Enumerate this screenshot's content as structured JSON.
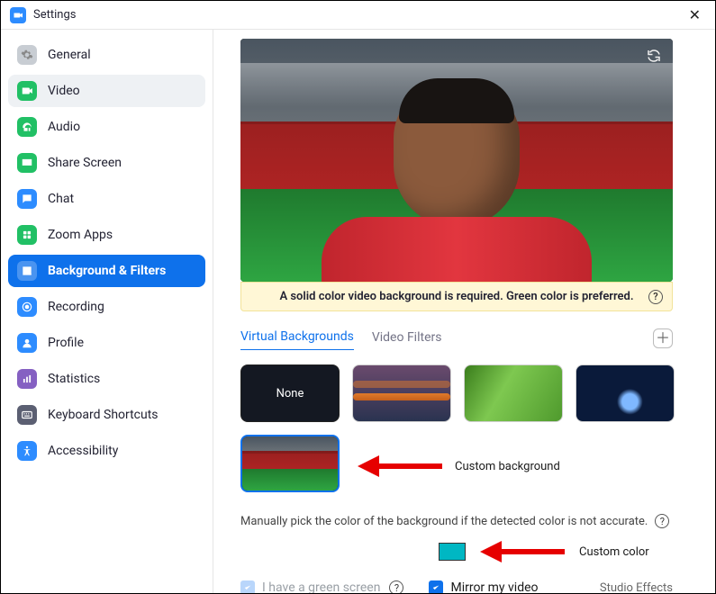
{
  "window": {
    "title": "Settings"
  },
  "sidebar": {
    "items": [
      {
        "label": "General"
      },
      {
        "label": "Video"
      },
      {
        "label": "Audio"
      },
      {
        "label": "Share Screen"
      },
      {
        "label": "Chat"
      },
      {
        "label": "Zoom Apps"
      },
      {
        "label": "Background & Filters"
      },
      {
        "label": "Recording"
      },
      {
        "label": "Profile"
      },
      {
        "label": "Statistics"
      },
      {
        "label": "Keyboard Shortcuts"
      },
      {
        "label": "Accessibility"
      }
    ]
  },
  "preview": {
    "note": "A solid color video background is required. Green color is preferred."
  },
  "tabs": {
    "virtual_backgrounds": "Virtual Backgrounds",
    "video_filters": "Video Filters"
  },
  "thumbs": {
    "none": "None"
  },
  "annotations": {
    "custom_background": "Custom background",
    "custom_color": "Custom color"
  },
  "manual": {
    "text": "Manually pick the color of the background if the detected color is not accurate."
  },
  "color": {
    "swatch_hex": "#00b7c3"
  },
  "checks": {
    "green_screen": "I have a green screen",
    "mirror": "Mirror my video",
    "studio": "Studio Effects"
  }
}
